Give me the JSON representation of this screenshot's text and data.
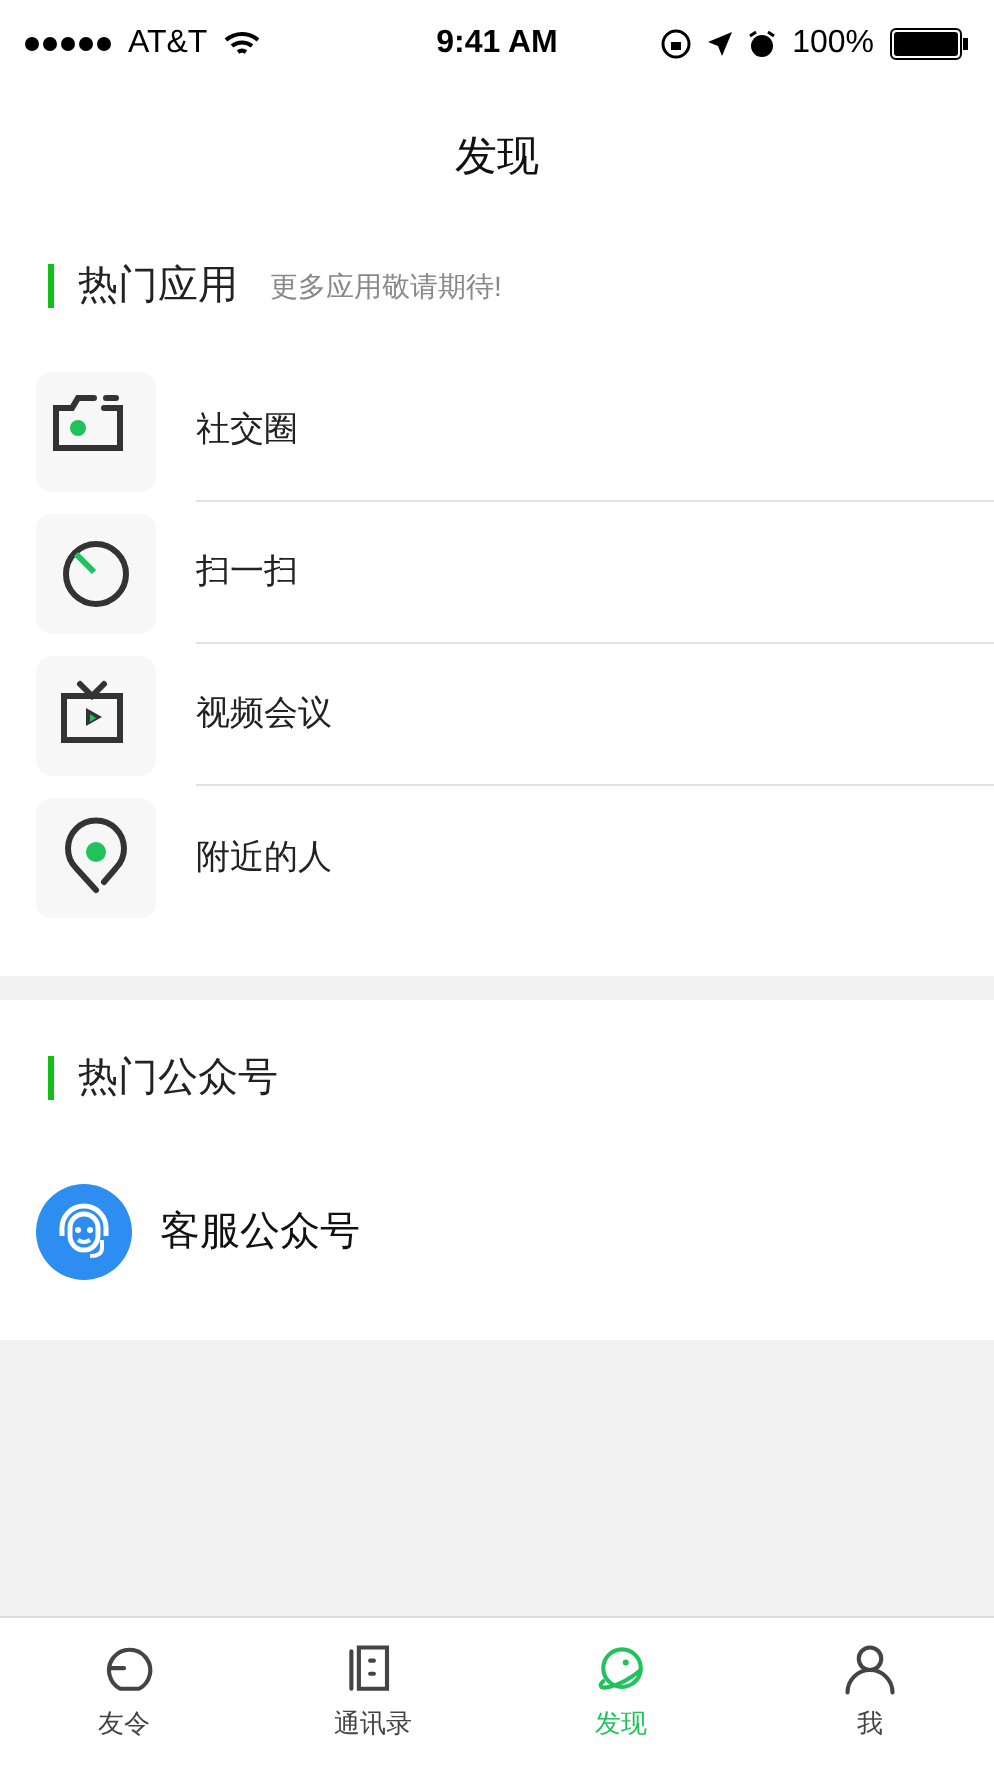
{
  "status_bar": {
    "carrier": "AT&T",
    "time": "9:41 AM",
    "battery": "100%"
  },
  "title": "发现",
  "apps_section": {
    "title": "热门应用",
    "subtitle": "更多应用敬请期待!",
    "items": [
      {
        "kind": "camera",
        "label": "社交圈"
      },
      {
        "kind": "scan",
        "label": "扫一扫"
      },
      {
        "kind": "tv",
        "label": "视频会议"
      },
      {
        "kind": "pin",
        "label": "附近的人"
      }
    ]
  },
  "accounts_section": {
    "title": "热门公众号",
    "items": [
      {
        "label": "客服公众号"
      }
    ]
  },
  "tab_bar": [
    {
      "kind": "chat",
      "label": "友令",
      "selected": false
    },
    {
      "kind": "contacts",
      "label": "通讯录",
      "selected": false
    },
    {
      "kind": "planet",
      "label": "发现",
      "selected": true
    },
    {
      "kind": "person",
      "label": "我",
      "selected": false
    }
  ]
}
